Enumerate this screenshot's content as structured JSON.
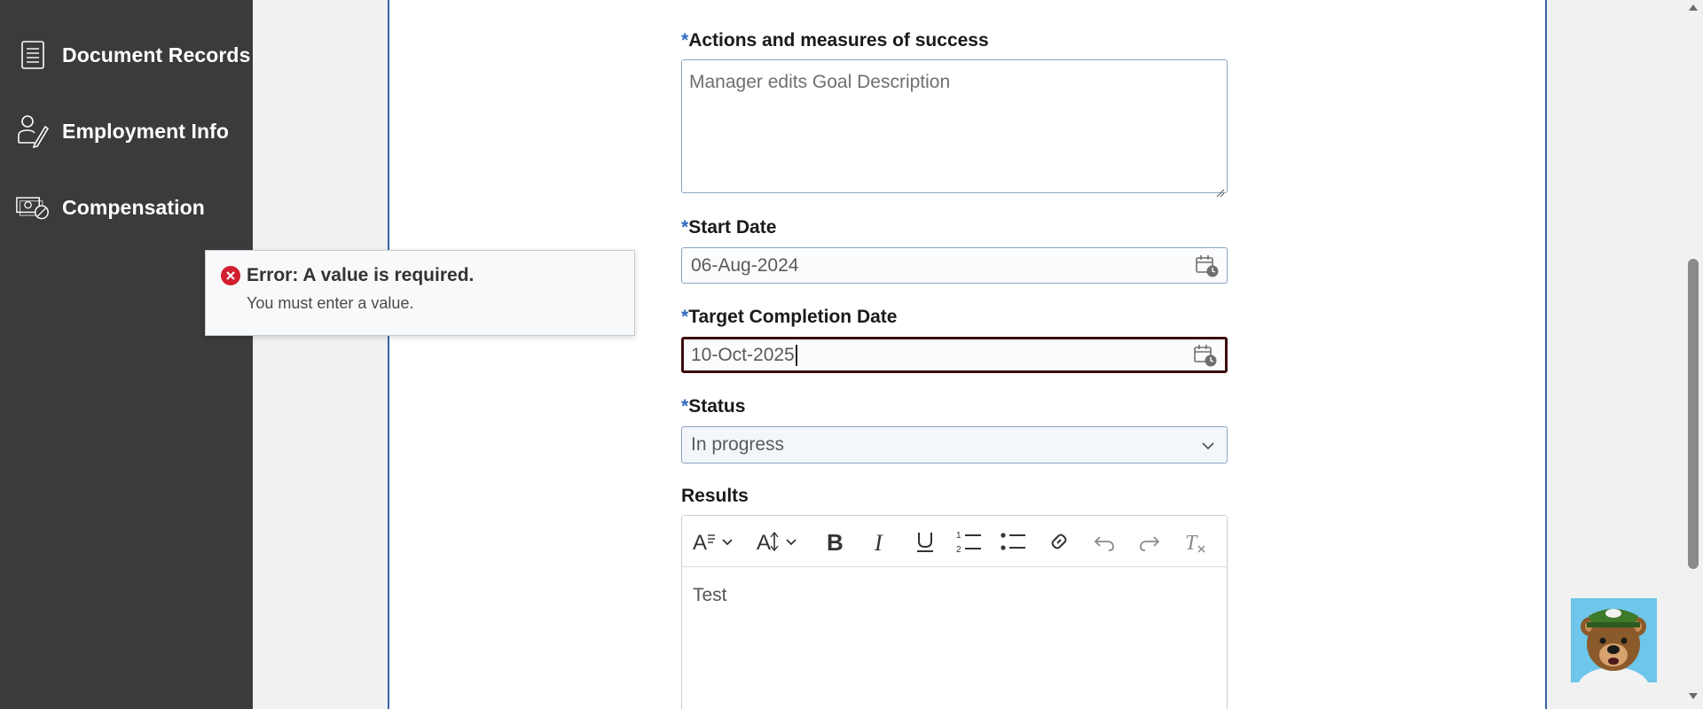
{
  "sidebar": {
    "items": [
      {
        "label": "Document Records",
        "icon": "document-icon"
      },
      {
        "label": "Employment Info",
        "icon": "person-edit-icon"
      },
      {
        "label": "Compensation",
        "icon": "compensation-icon"
      }
    ]
  },
  "form": {
    "actions": {
      "required_mark": "*",
      "label": "Actions and measures of success",
      "value": "Manager edits Goal Description"
    },
    "start_date": {
      "required_mark": "*",
      "label": "Start Date",
      "value": "06-Aug-2024"
    },
    "target_date": {
      "required_mark": "*",
      "label": "Target Completion Date",
      "value": "10-Oct-2025"
    },
    "status": {
      "required_mark": "*",
      "label": "Status",
      "value": "In progress"
    },
    "results": {
      "label": "Results",
      "value": "Test",
      "toolbar": [
        "font-style-icon",
        "font-size-icon",
        "bold-icon",
        "italic-icon",
        "underline-icon",
        "numbered-list-icon",
        "bullet-list-icon",
        "link-icon",
        "undo-icon",
        "redo-icon",
        "clear-format-icon"
      ]
    }
  },
  "error_tooltip": {
    "title": "Error: A value is required.",
    "message": "You must enter a value."
  },
  "colors": {
    "sidebar_bg": "#3b3b3b",
    "accent": "#2e6ac0",
    "error": "#d11f30",
    "panel_border": "#3a63a8"
  }
}
